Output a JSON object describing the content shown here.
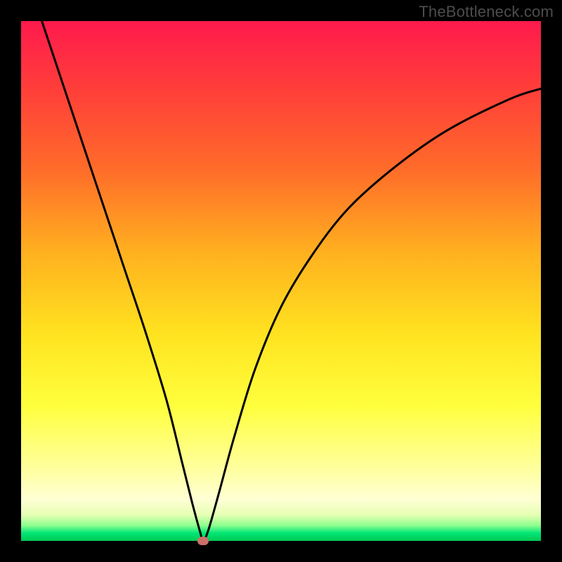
{
  "watermark": "TheBottleneck.com",
  "chart_data": {
    "type": "line",
    "title": "",
    "xlabel": "",
    "ylabel": "",
    "xlim": [
      0,
      100
    ],
    "ylim": [
      0,
      100
    ],
    "grid": false,
    "legend": false,
    "background_gradient": {
      "top_color": "#ff1a4d",
      "bottom_color": "#00c853",
      "meaning": "top = high bottleneck, bottom = low bottleneck"
    },
    "minimum_point": {
      "x": 35,
      "y": 0,
      "color": "#cc6f6a"
    },
    "series": [
      {
        "name": "bottleneck-curve",
        "color": "#000000",
        "x": [
          4,
          8,
          12,
          16,
          20,
          24,
          28,
          31,
          33,
          34.5,
          35,
          36,
          38,
          41,
          45,
          50,
          56,
          63,
          72,
          82,
          94,
          100
        ],
        "y": [
          100,
          88,
          76,
          64,
          52,
          40,
          27,
          15,
          7,
          1.5,
          0,
          2,
          9,
          20,
          33,
          45,
          55,
          64,
          72,
          79,
          85,
          87
        ]
      }
    ]
  }
}
